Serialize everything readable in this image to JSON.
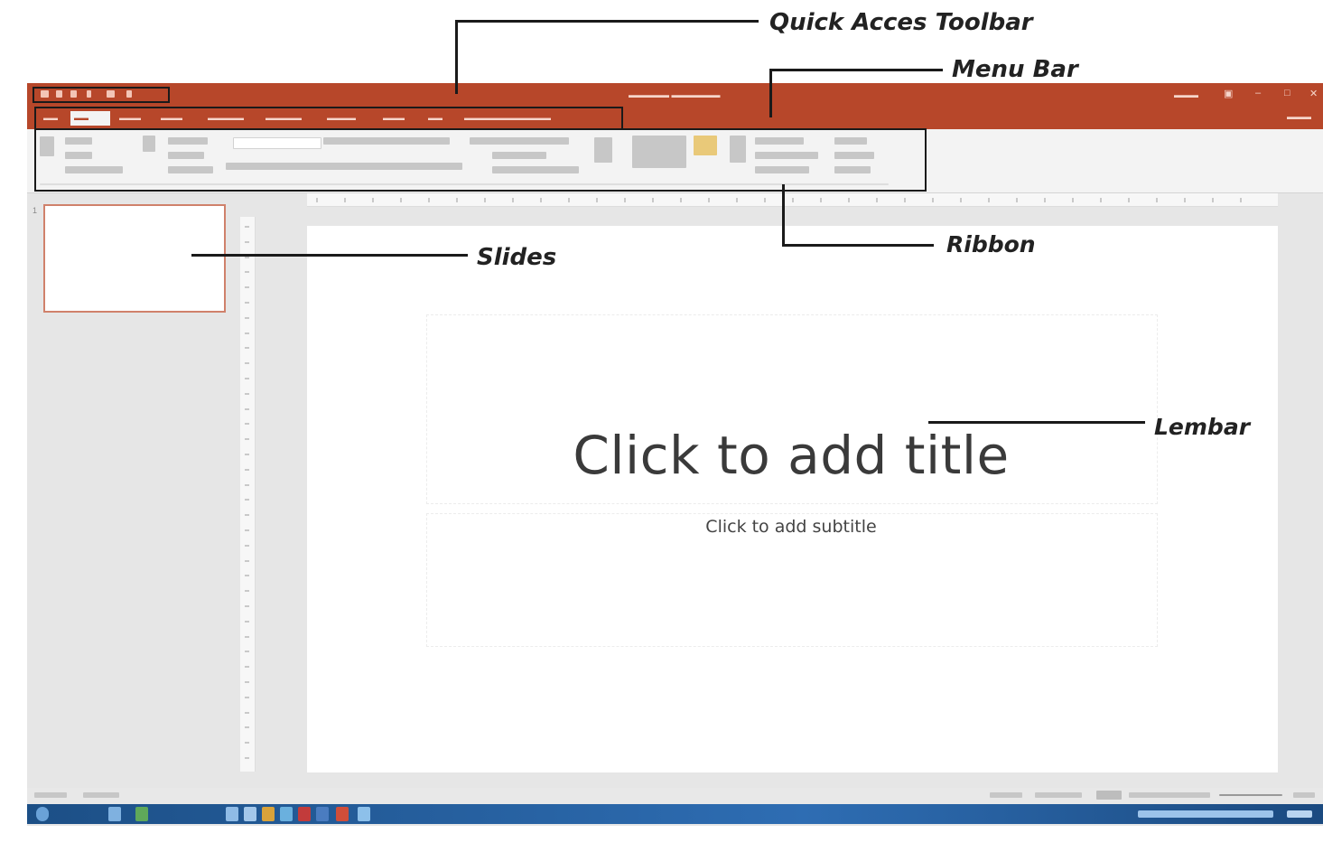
{
  "annotations": {
    "quick_access_toolbar": "Quick Acces Toolbar",
    "menu_bar": "Menu Bar",
    "ribbon": "Ribbon",
    "slides": "Slides",
    "lembar": "Lembar"
  },
  "slide": {
    "title_placeholder": "Click to add title",
    "subtitle_placeholder": "Click to add subtitle"
  },
  "colors": {
    "accent": "#b7472a",
    "taskbar": "#1c4f86",
    "annotation_line": "#1a1a1a"
  },
  "icons": [
    "save-icon",
    "undo-icon",
    "redo-icon",
    "minimize-icon",
    "maximize-icon",
    "close-icon",
    "start-icon"
  ]
}
